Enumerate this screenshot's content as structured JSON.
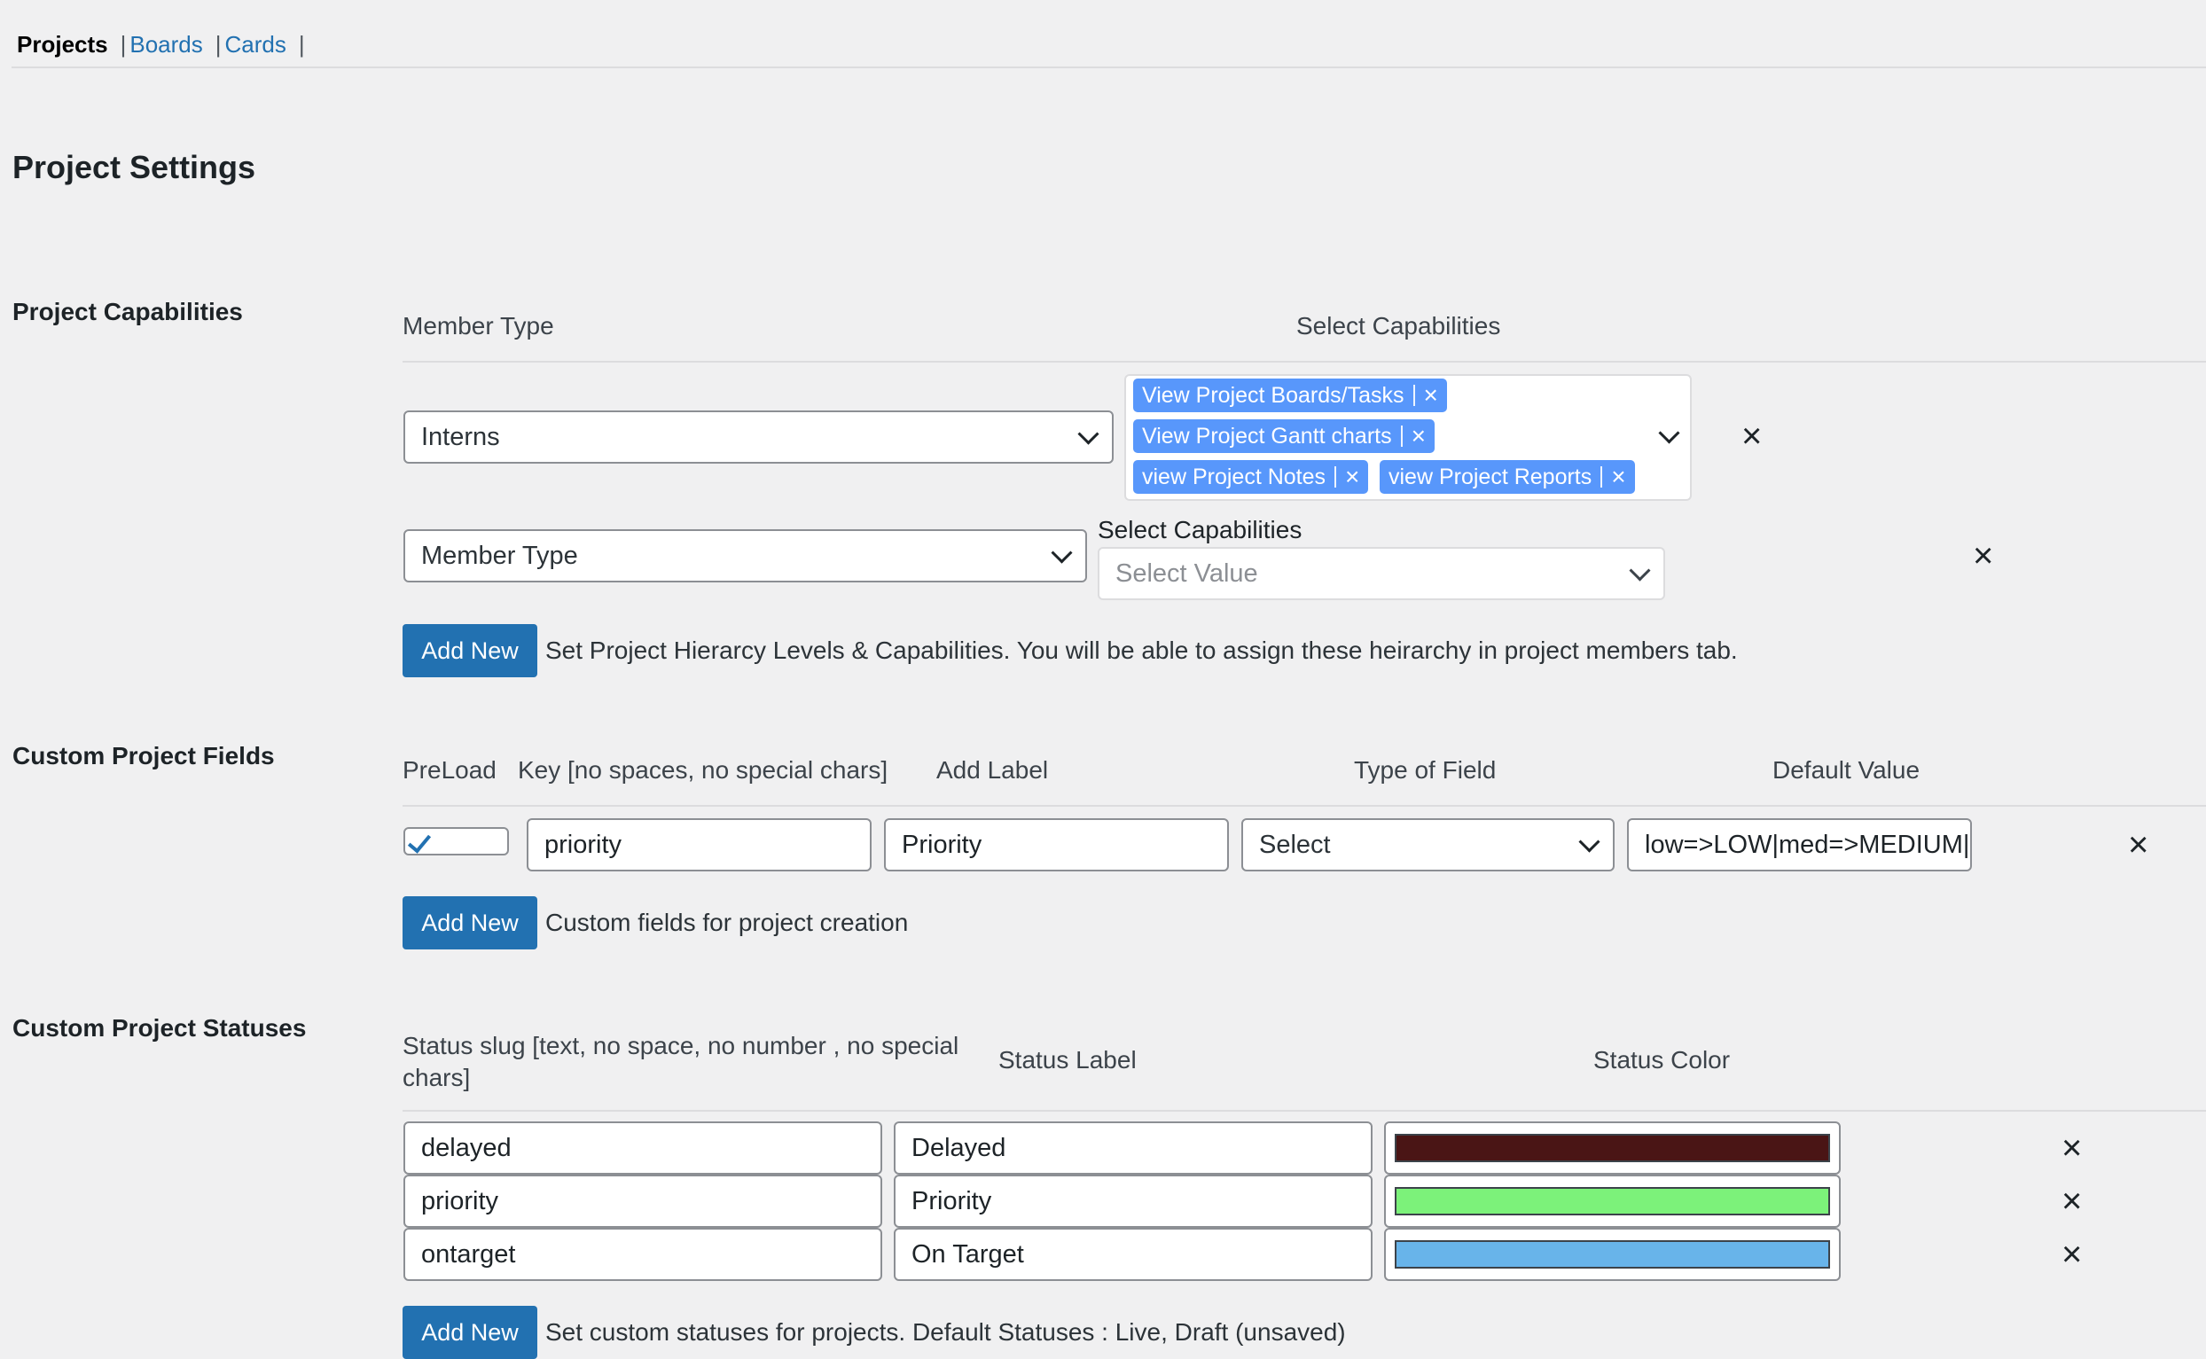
{
  "tabs": {
    "current": "Projects",
    "sep1": "|",
    "boards": "Boards",
    "sep2": "|",
    "cards": "Cards",
    "sep3": "|"
  },
  "page_title": "Project Settings",
  "capabilities": {
    "title": "Project Capabilities",
    "col_member_type": "Member Type",
    "col_select_capabilities": "Select Capabilities",
    "row1": {
      "member_type": "Interns",
      "chips": [
        "View Project Boards/Tasks",
        "View Project Gantt charts",
        "view Project Notes",
        "view Project Reports"
      ]
    },
    "row2": {
      "member_type": "Member Type",
      "capabilities_label": "Select Capabilities",
      "capabilities_placeholder": "Select Value"
    },
    "add_button": "Add New",
    "help": "Set Project Hierarcy Levels & Capabilities. You will be able to assign these heirarchy in project members tab."
  },
  "fields": {
    "title": "Custom Project Fields",
    "col_preload": "PreLoad",
    "col_key": "Key [no spaces, no special chars]",
    "col_label": "Add Label",
    "col_type": "Type of Field",
    "col_default": "Default Value",
    "row": {
      "preload": true,
      "key": "priority",
      "label": "Priority",
      "type": "Select",
      "default": "low=>LOW|med=>MEDIUM|"
    },
    "add_button": "Add New",
    "help": "Custom fields for project creation"
  },
  "statuses": {
    "title": "Custom Project Statuses",
    "col_slug_line1": "Status slug [text, no space, no number , no special",
    "col_slug_line2": "chars]",
    "col_label": "Status Label",
    "col_color": "Status Color",
    "rows": [
      {
        "slug": "delayed",
        "label": "Delayed",
        "color": "#4a1515"
      },
      {
        "slug": "priority",
        "label": "Priority",
        "color": "#7cf27a"
      },
      {
        "slug": "ontarget",
        "label": "On Target",
        "color": "#68b4ea"
      }
    ],
    "add_button": "Add New",
    "help": "Set custom statuses for projects. Default Statuses : Live, Draft (unsaved)"
  },
  "icons": {
    "remove": "close-icon",
    "dropdown": "chevron-down-icon",
    "check": "checkmark-icon"
  },
  "colors": {
    "accent": "#2271b1",
    "chip": "#5897fb",
    "background": "#f0f0f1"
  }
}
